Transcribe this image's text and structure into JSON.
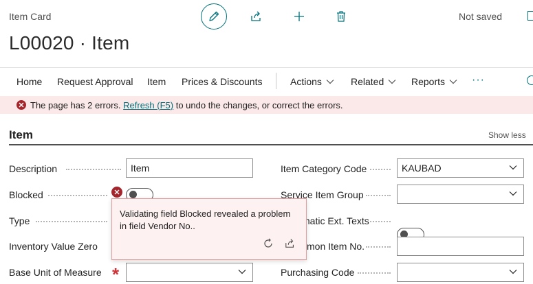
{
  "header": {
    "breadcrumb": "Item Card",
    "title": "L00020 · Item",
    "save_state": "Not saved"
  },
  "actions": [
    {
      "label": "Home",
      "has_chevron": false
    },
    {
      "label": "Request Approval",
      "has_chevron": false
    },
    {
      "label": "Item",
      "has_chevron": false
    },
    {
      "label": "Prices & Discounts",
      "has_chevron": false
    },
    {
      "label": "Actions",
      "has_chevron": true
    },
    {
      "label": "Related",
      "has_chevron": true
    },
    {
      "label": "Reports",
      "has_chevron": true
    }
  ],
  "more": "···",
  "error_bar": {
    "before": "The page has 2 errors. ",
    "link": "Refresh (F5)",
    "after": " to undo the changes, or correct the errors."
  },
  "section": {
    "title": "Item",
    "toggle_label": "Show less"
  },
  "fields_left": [
    {
      "label": "Description",
      "value": "Item",
      "kind": "text"
    },
    {
      "label": "Blocked",
      "value": false,
      "kind": "toggle"
    },
    {
      "label": "Type",
      "kind": "hidden"
    },
    {
      "label": "Inventory Value Zero",
      "kind": "hidden"
    },
    {
      "label": "Base Unit of Measure",
      "value": "",
      "kind": "select",
      "required": true
    }
  ],
  "fields_right": [
    {
      "label": "Item Category Code",
      "value": "KAUBAD",
      "kind": "select"
    },
    {
      "label": "Service Item Group",
      "value": "",
      "kind": "select"
    },
    {
      "label": "Automatic Ext. Texts",
      "visible_label": "matic Ext. Texts",
      "value": false,
      "kind": "toggle"
    },
    {
      "label": "Common Item No.",
      "visible_label": "mon Item No.",
      "value": "",
      "kind": "text"
    },
    {
      "label": "Purchasing Code",
      "value": "",
      "kind": "select"
    }
  ],
  "validation_popup": {
    "message": "Validating field Blocked revealed a problem in field Vendor No.."
  },
  "colors": {
    "accent": "#00707a",
    "error": "#a4262c",
    "error_bg": "#fbe8e8",
    "required": "#d13438"
  }
}
